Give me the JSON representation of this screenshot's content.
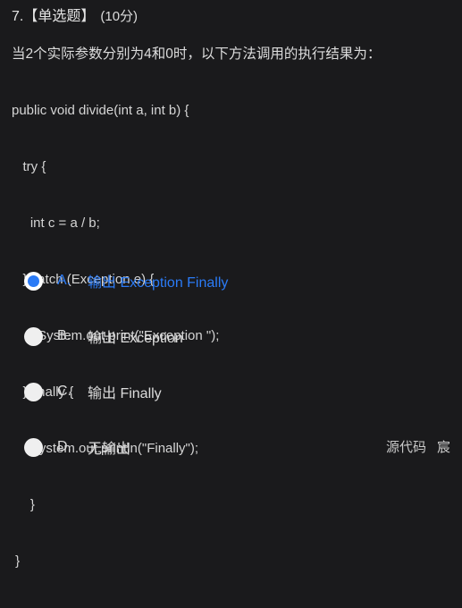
{
  "question": {
    "number": "7.",
    "type_label": "【单选题】",
    "score_label": "(10分)",
    "stem": "当2个实际参数分别为4和0时，以下方法调用的执行结果为：",
    "code_lines": [
      "public void divide(int a, int b) {",
      "   try {",
      "     int c = a / b;",
      "   } catch (Exception e) {",
      "       System.out.print(\"Exception \");",
      "   } finally {",
      "     System.out.println(\"Finally\");",
      "     }",
      " }"
    ]
  },
  "options": [
    {
      "letter": "A.",
      "text": "输出 Exception Finally",
      "selected": true
    },
    {
      "letter": "B.",
      "text": "输出 Exception",
      "selected": false
    },
    {
      "letter": "C.",
      "text": "输出 Finally",
      "selected": false
    },
    {
      "letter": "D.",
      "text": "无输出",
      "selected": false
    }
  ],
  "watermark": {
    "left": "源代码",
    "right": "宸"
  },
  "colors": {
    "background": "#1a1a1c",
    "text": "#dcdcdc",
    "accent": "#2b7bf6",
    "radio_fill": "#efefef"
  }
}
